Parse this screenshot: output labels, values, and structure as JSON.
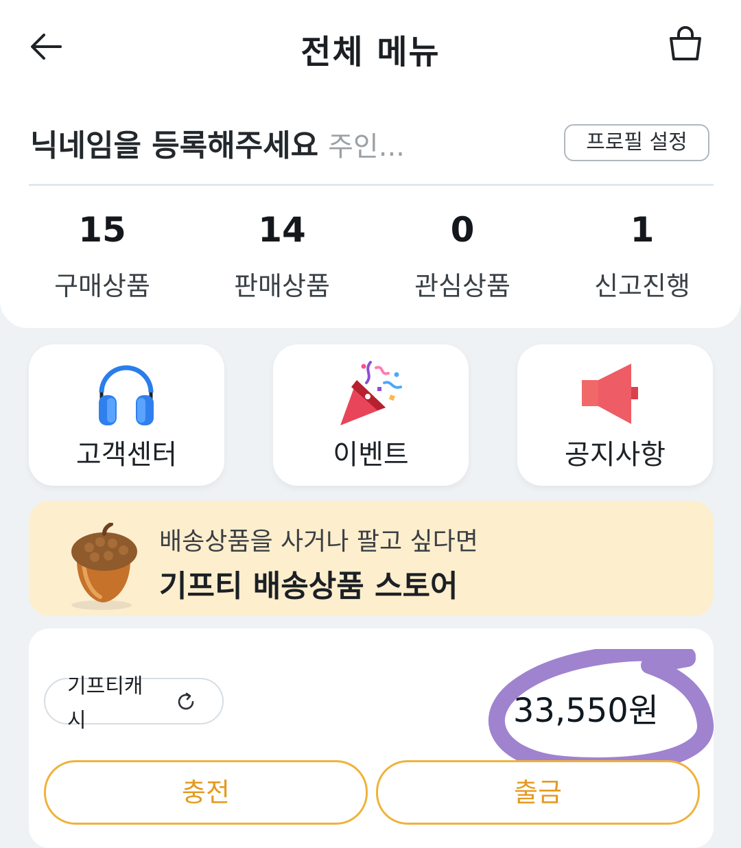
{
  "header": {
    "title": "전체 메뉴",
    "back_icon": "arrow-left-icon",
    "cart_icon": "shopping-bag-icon"
  },
  "profile": {
    "nickname": "닉네임을 등록해주세요",
    "subtitle": "주인...",
    "settings_button": "프로필 설정"
  },
  "stats": [
    {
      "value": "15",
      "label": "구매상품"
    },
    {
      "value": "14",
      "label": "판매상품"
    },
    {
      "value": "0",
      "label": "관심상품"
    },
    {
      "value": "1",
      "label": "신고진행"
    }
  ],
  "menu_cards": [
    {
      "label": "고객센터",
      "icon": "headphones-icon"
    },
    {
      "label": "이벤트",
      "icon": "party-popper-icon"
    },
    {
      "label": "공지사항",
      "icon": "megaphone-icon"
    }
  ],
  "banner": {
    "line1": "배송상품을 사거나 팔고 싶다면",
    "line2": "기프티 배송상품 스토어",
    "icon": "acorn-icon"
  },
  "cash": {
    "label": "기프티캐시",
    "amount": "33,550원",
    "refresh_icon": "refresh-icon",
    "charge_button": "충전",
    "withdraw_button": "출금"
  },
  "colors": {
    "accent_orange": "#efb23a",
    "banner_bg": "#fdeecd",
    "page_bg": "#eef2f5",
    "annotation_purple": "#9f83cf"
  }
}
